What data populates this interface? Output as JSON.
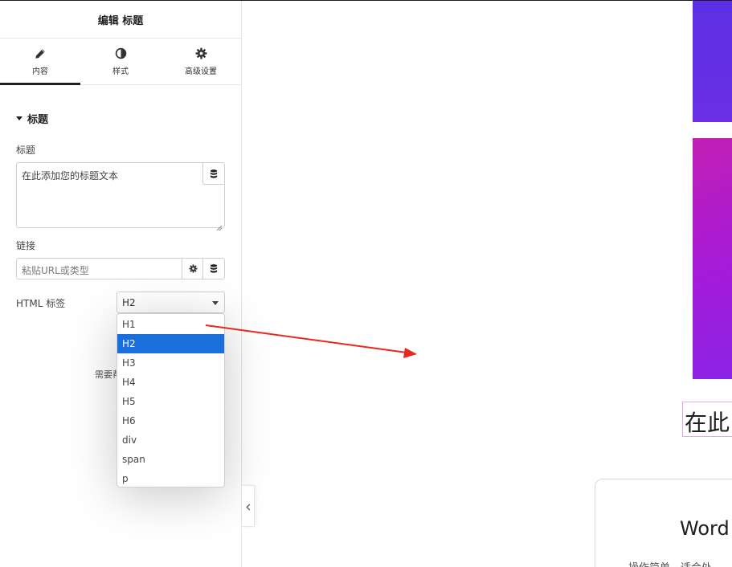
{
  "panel": {
    "title": "编辑 标题",
    "tabs": [
      {
        "label": "内容",
        "icon": "pencil-icon",
        "active": true
      },
      {
        "label": "样式",
        "icon": "contrast-icon",
        "active": false
      },
      {
        "label": "高级设置",
        "icon": "gear-icon",
        "active": false
      }
    ],
    "section": {
      "title": "标题"
    },
    "title_field": {
      "label": "标题",
      "value": "在此添加您的标题文本"
    },
    "link_field": {
      "label": "链接",
      "placeholder": "粘贴URL或类型"
    },
    "html_tag": {
      "label": "HTML 标签",
      "value": "H2",
      "options": [
        "H1",
        "H2",
        "H3",
        "H4",
        "H5",
        "H6",
        "div",
        "span",
        "p"
      ]
    },
    "help_text": "需要帮"
  },
  "canvas": {
    "heading_preview": "在此",
    "card_title": "Word",
    "card_text": "操作简单，适合处"
  },
  "colors": {
    "accent_selected": "#1a6fdc",
    "block_purple": "#5c2fe4",
    "block_magenta": "#c21fb4",
    "arrow_red": "#e8281e"
  }
}
